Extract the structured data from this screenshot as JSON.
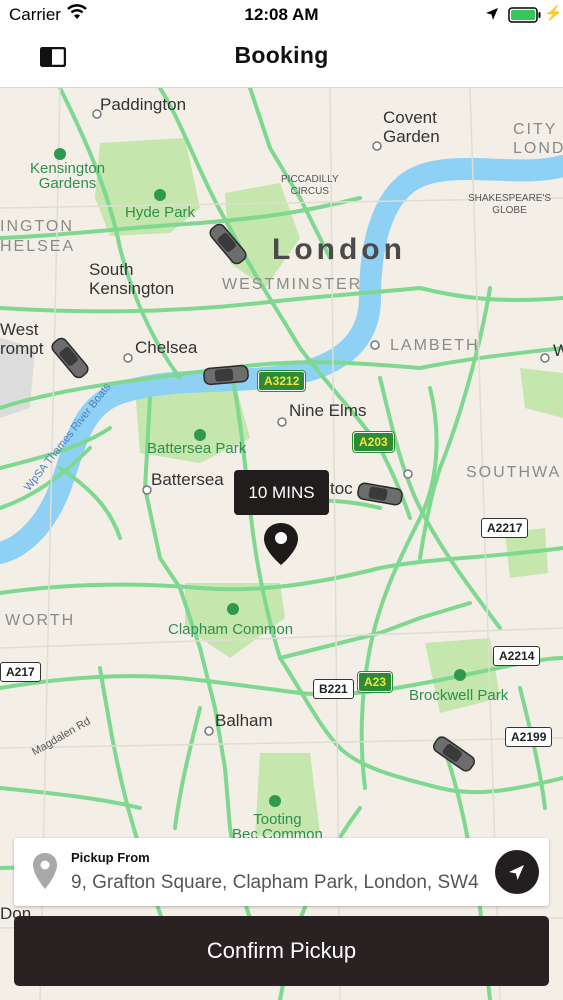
{
  "status_bar": {
    "carrier": "Carrier",
    "time": "12:08 AM"
  },
  "nav": {
    "title": "Booking",
    "menu_icon": "sidebar-toggle-icon"
  },
  "map": {
    "labels": {
      "paddington": "Paddington",
      "covent_garden": "Covent\nGarden",
      "city_of_london": "CITY\nLOND",
      "kensington_gardens": "Kensington\nGardens",
      "hyde_park": "Hyde Park",
      "piccadilly_circus": "PICCADILLY\nCIRCUS",
      "shakespeares_globe": "SHAKESPEARE'S\nGLOBE",
      "kensington_chelsea": "INGTON\nHELSEA",
      "london": "London",
      "westminster": "WESTMINSTER",
      "south_kensington": "South\nKensington",
      "west_brompton": "West\nrompt",
      "chelsea": "Chelsea",
      "lambeth": "LAMBETH",
      "w_edge": "W",
      "nine_elms": "Nine Elms",
      "battersea_park": "Battersea Park",
      "thames_river_boats": "WpSA Thames River Boats",
      "battersea": "Battersea",
      "stockwell_partial": "toc",
      "southwark": "SOUTHWA",
      "wandsworth": "WORTH",
      "clapham_common": "Clapham Common",
      "brockwell_park": "Brockwell Park",
      "magdalen_rd": "Magdalen Rd",
      "balham": "Balham",
      "tooting_bec_common": "Tooting\nBec Common",
      "don_partial": "Don"
    },
    "road_shields": {
      "a3212": "A3212",
      "a203": "A203",
      "a2217": "A2217",
      "a217": "A217",
      "a2214": "A2214",
      "b221": "B221",
      "a23": "A23",
      "a2199": "A2199"
    },
    "eta": "10 MINS"
  },
  "pickup": {
    "label": "Pickup From",
    "address": "9, Grafton Square, Clapham Park, London, SW4",
    "locate_icon": "navigation-arrow-icon"
  },
  "confirm_button": "Confirm Pickup",
  "colors": {
    "dark": "#231f20",
    "road": "#7ed890",
    "water": "#8fd0f5",
    "park": "#bfe3a5",
    "land": "#f3efe6"
  }
}
